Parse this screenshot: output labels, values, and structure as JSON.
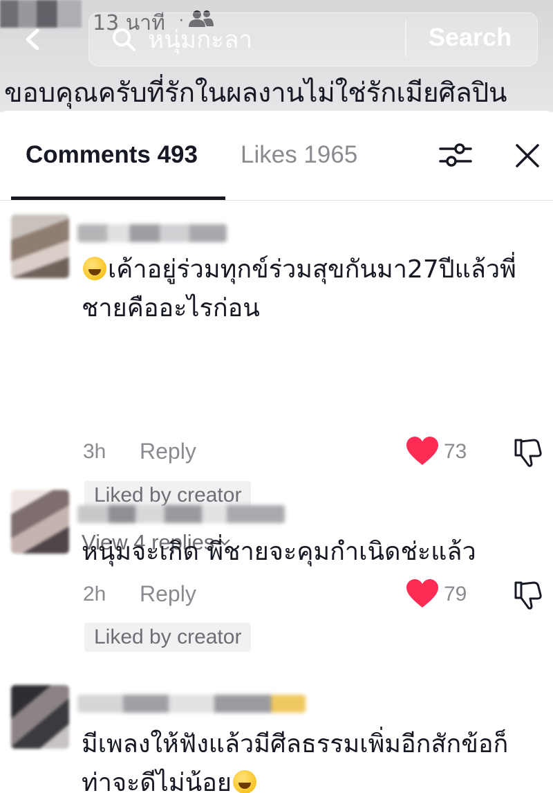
{
  "video_overlay": {
    "time_ago": "13 นาที",
    "separator": "·",
    "search_term": "หนุ่มกะลา",
    "search_button": "Search",
    "caption_line1": "ขอบคุณครับที่รักในผลงานไม่ใช่รักเมียศิลปิน"
  },
  "tabs": {
    "comments_label": "Comments 493",
    "likes_label": "Likes 1965"
  },
  "comments": [
    {
      "text_before_emoji": "",
      "text": "เค้าอยู่ร่วมทุกข์ร่วมสุขกันมา27ปีแล้วพี่ชายคืออะไรก่อน",
      "time": "3h",
      "reply_label": "Reply",
      "likes": "73",
      "badge": "Liked by creator",
      "view_replies": "View 4 replies"
    },
    {
      "text": "หนุ่มจะเกิด พี่ชายจะคุมกำเนิดช่ะแล้ว",
      "time": "2h",
      "reply_label": "Reply",
      "likes": "79",
      "badge": "Liked by creator"
    },
    {
      "text_line1": "มีเพลงให้ฟังแล้วมีศีลธรรมเพิ่มอีกสักข้อก็",
      "text_line2": "ท่าจะดีไม่น้อย"
    }
  ],
  "colors": {
    "heart": "#fe2c55",
    "text_primary": "#161823",
    "text_secondary": "#8a8b91",
    "badge_bg": "#f1f1f2"
  },
  "icons": [
    "back-arrow-icon",
    "people-icon",
    "search-icon",
    "filter-icon",
    "close-icon",
    "heart-icon",
    "dislike-icon",
    "chevron-down-icon",
    "grinning-sweat-emoji-icon",
    "wink-emoji-icon"
  ]
}
